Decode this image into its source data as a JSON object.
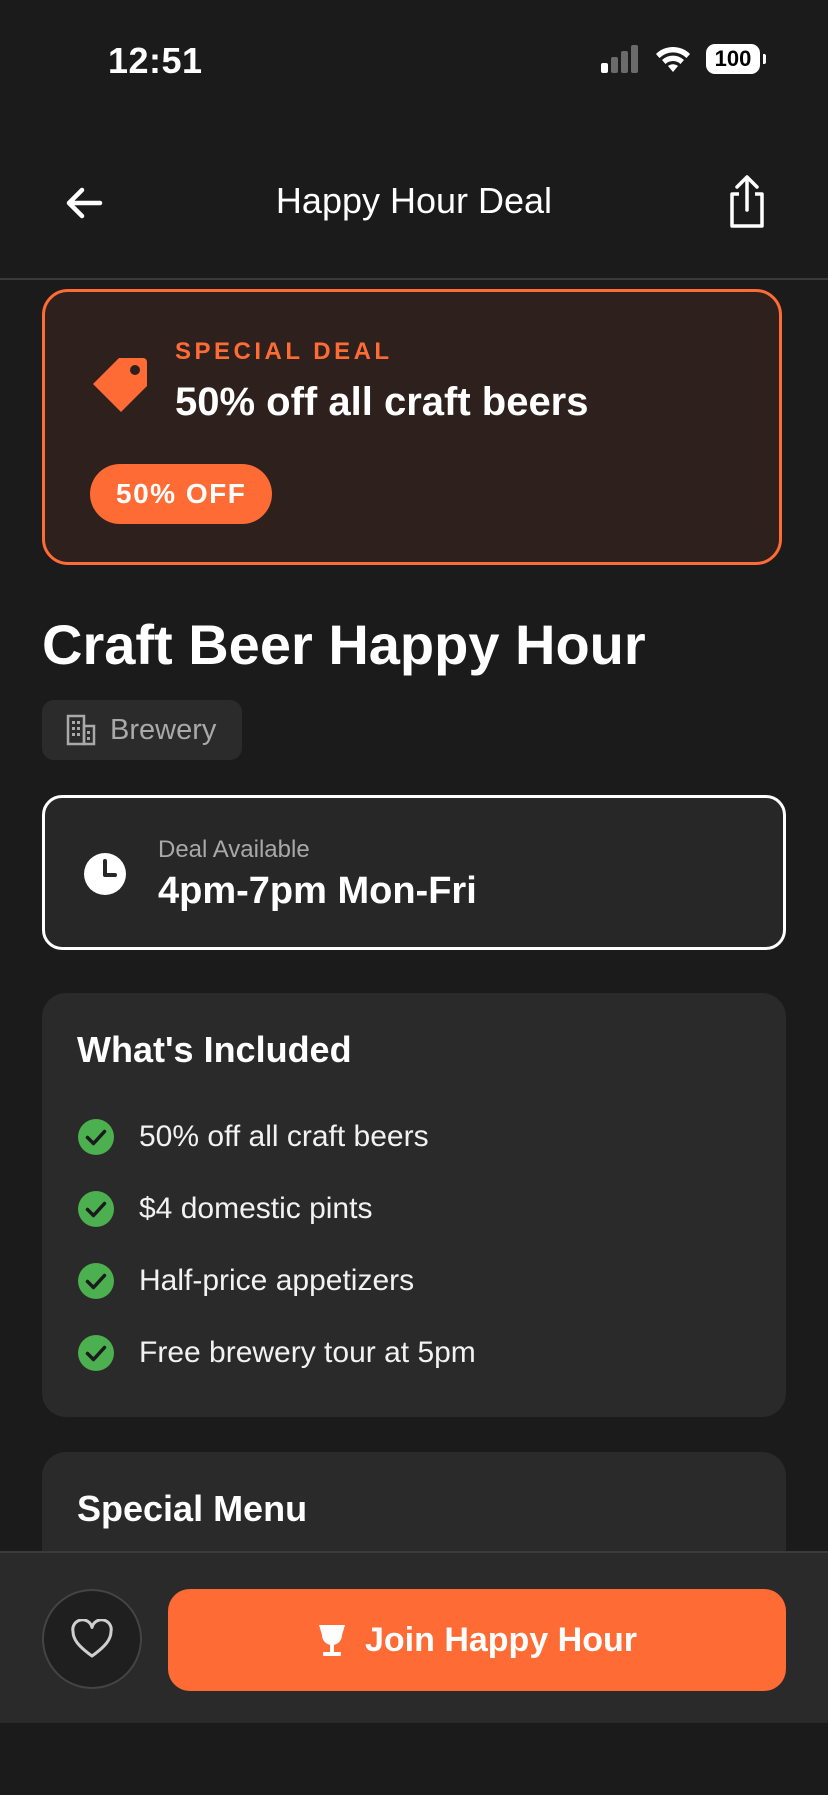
{
  "status_bar": {
    "time": "12:51",
    "battery": "100",
    "icons": [
      "cellular-signal-icon",
      "wifi-icon",
      "battery-icon"
    ]
  },
  "nav": {
    "title": "Happy Hour Deal",
    "back_icon": "arrow-left-icon",
    "share_icon": "share-icon"
  },
  "deal": {
    "label": "SPECIAL DEAL",
    "title": "50% off all craft beers",
    "badge": "50% OFF",
    "icon": "tag-icon"
  },
  "venue": {
    "title": "Craft Beer Happy Hour",
    "category": "Brewery",
    "category_icon": "building-icon"
  },
  "availability": {
    "label": "Deal Available",
    "value": "4pm-7pm Mon-Fri",
    "icon": "clock-icon"
  },
  "included": {
    "title": "What's Included",
    "items": [
      "50% off all craft beers",
      "$4 domestic pints",
      "Half-price appetizers",
      "Free brewery tour at 5pm"
    ]
  },
  "special_menu": {
    "title": "Special Menu"
  },
  "actions": {
    "favorite_icon": "heart-icon",
    "join_label": "Join Happy Hour",
    "join_icon": "cocktail-glass-icon"
  },
  "colors": {
    "accent": "#ff6b35",
    "background": "#1b1b1b",
    "card": "#2a2a2a",
    "check": "#4caf50"
  }
}
